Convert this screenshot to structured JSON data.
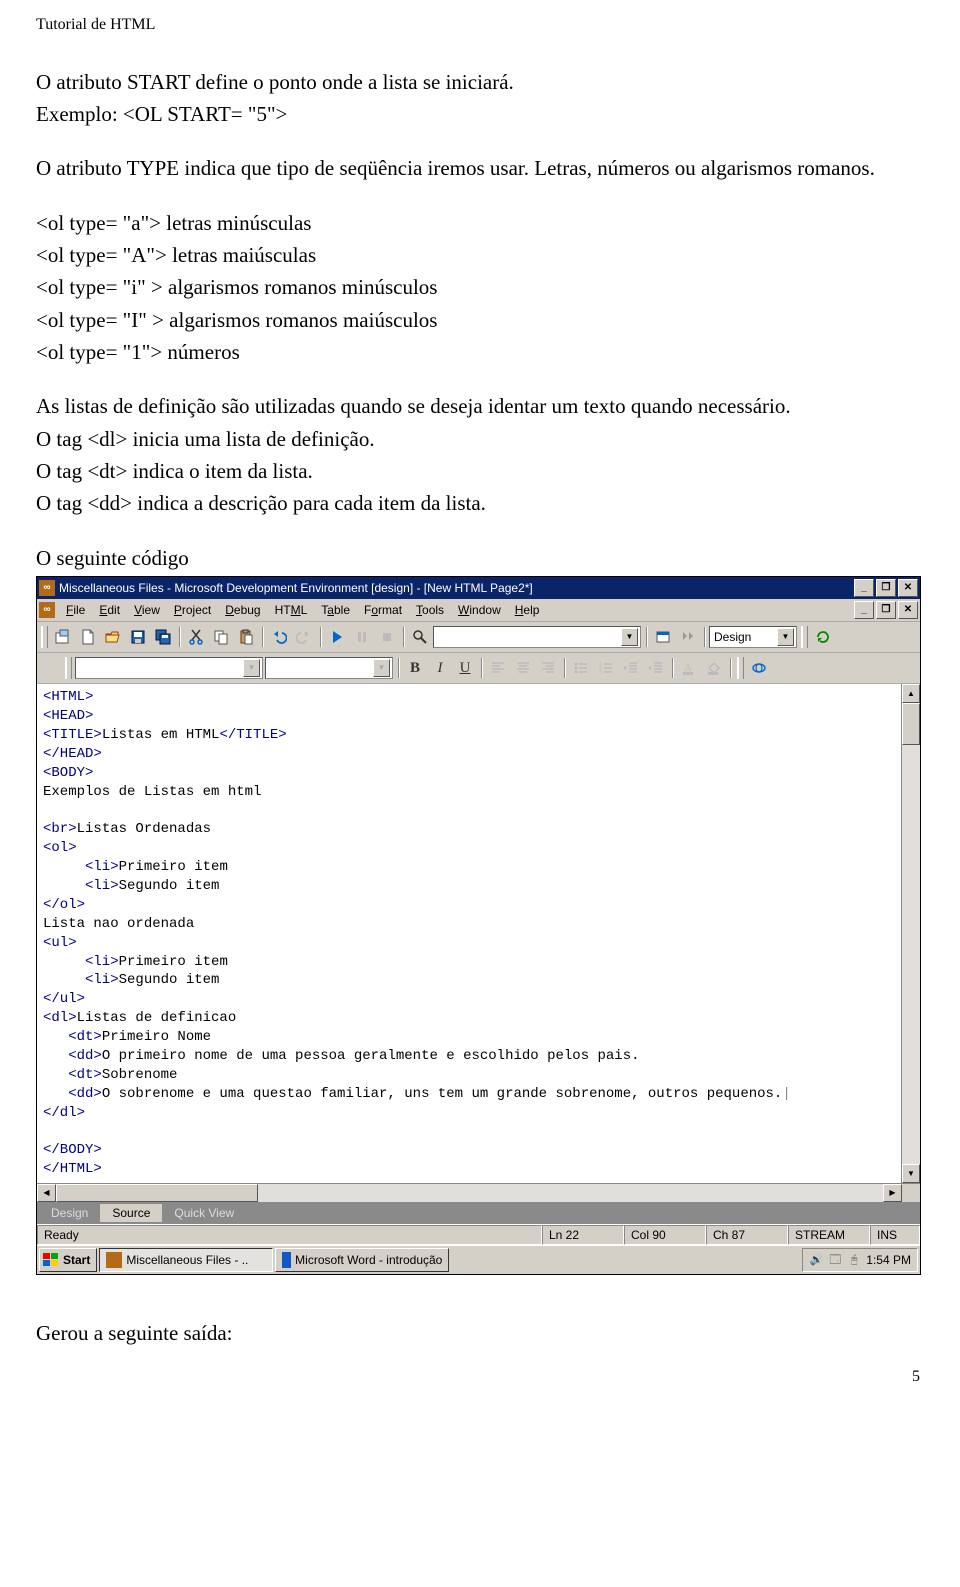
{
  "doc": {
    "header": "Tutorial de HTML",
    "p1": "O atributo START define o ponto onde a lista se iniciará.",
    "p2": "Exemplo: <OL START= \"5\">",
    "p3": "O atributo TYPE indica que tipo de seqüência iremos usar. Letras, números ou algarismos romanos.",
    "p4": "<ol type= \"a\"> letras minúsculas",
    "p5": "<ol type= \"A\"> letras maiúsculas",
    "p6": "<ol type= \"i\" > algarismos romanos minúsculos",
    "p7": "<ol type= \"I\" > algarismos romanos maiúsculos",
    "p8": "<ol type= \"1\"> números",
    "p9": "As listas de definição são utilizadas quando se deseja identar um texto quando necessário.",
    "p10": "O tag <dl> inicia uma lista de definição.",
    "p11": "O tag <dt> indica o item da lista.",
    "p12": "O tag <dd> indica a descrição para cada item da lista.",
    "p13": "O seguinte código",
    "p14": "Gerou a seguinte saída:",
    "page_number": "5"
  },
  "ide": {
    "title": "Miscellaneous Files - Microsoft Development Environment [design] - [New HTML Page2*]",
    "menus": [
      "File",
      "Edit",
      "View",
      "Project",
      "Debug",
      "HTML",
      "Table",
      "Format",
      "Tools",
      "Window",
      "Help"
    ],
    "dropdown_design": "Design",
    "viewtabs": {
      "design": "Design",
      "source": "Source",
      "quick": "Quick View"
    },
    "status": {
      "ready": "Ready",
      "ln": "Ln 22",
      "col": "Col 90",
      "ch": "Ch 87",
      "stream": "STREAM",
      "ins": "INS"
    },
    "taskbar": {
      "start": "Start",
      "task1": "Miscellaneous Files - ..",
      "task2": "Microsoft Word - introdução",
      "clock": "1:54 PM"
    },
    "code": {
      "l1": "<HTML>",
      "l2": "<HEAD>",
      "l3_a": "<TITLE>",
      "l3_b": "Listas em HTML",
      "l3_c": "</TITLE>",
      "l4": "</HEAD>",
      "l5": "<BODY>",
      "l6": "Exemplos de Listas em html",
      "l7": "",
      "l8_a": "<br>",
      "l8_b": "Listas Ordenadas",
      "l9": "<ol>",
      "l10_a": "     <li>",
      "l10_b": "Primeiro item",
      "l11_a": "     <li>",
      "l11_b": "Segundo item",
      "l12": "</ol>",
      "l13": "Lista nao ordenada",
      "l14": "<ul>",
      "l15_a": "     <li>",
      "l15_b": "Primeiro item",
      "l16_a": "     <li>",
      "l16_b": "Segundo item",
      "l17": "</ul>",
      "l18_a": "<dl>",
      "l18_b": "Listas de definicao",
      "l19_a": "   <dt>",
      "l19_b": "Primeiro Nome",
      "l20_a": "   <dd>",
      "l20_b": "O primeiro nome de uma pessoa geralmente e escolhido pelos pais.",
      "l21_a": "   <dt>",
      "l21_b": "Sobrenome",
      "l22_a": "   <dd>",
      "l22_b": "O sobrenome e uma questao familiar, uns tem um grande sobrenome, outros pequenos.",
      "l23": "</dl>",
      "l24": "",
      "l25": "</BODY>",
      "l26": "</HTML>"
    }
  }
}
